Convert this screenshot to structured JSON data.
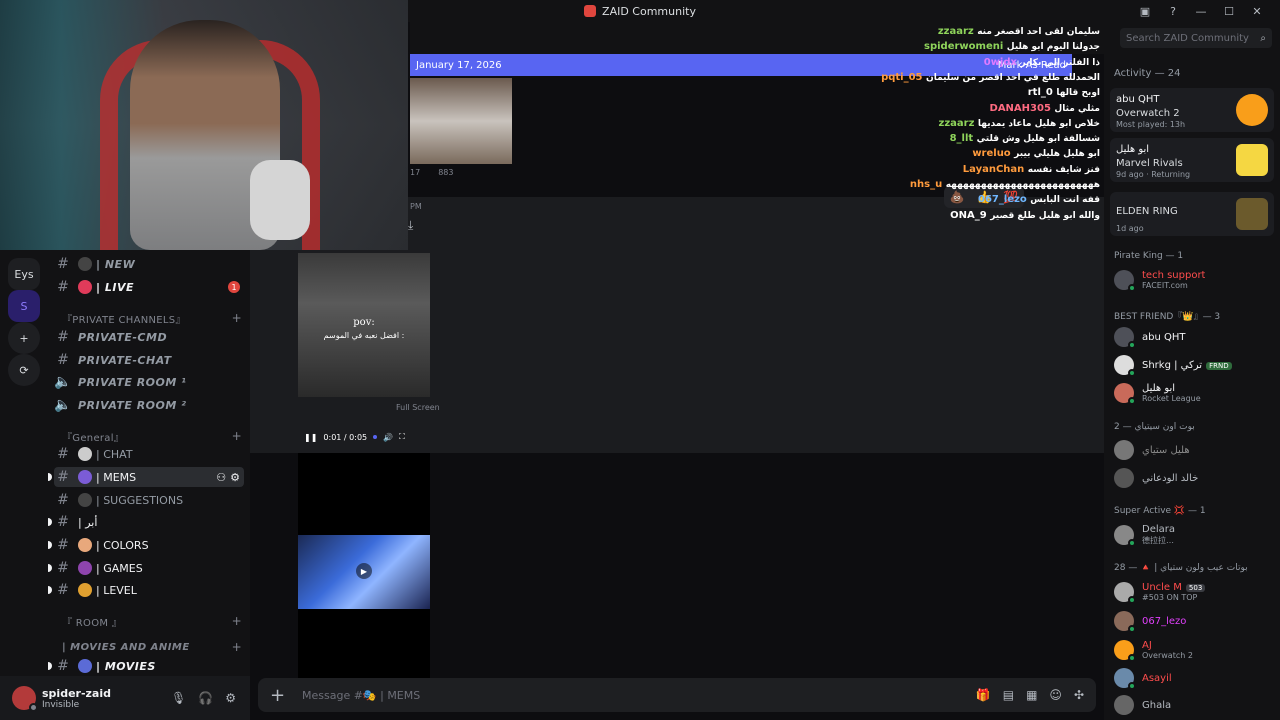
{
  "window": {
    "title": "ZAID Community",
    "controls": [
      "—",
      "☐",
      "✕"
    ]
  },
  "rail": {
    "items": [
      "Eys",
      "S",
      "+",
      "⟳"
    ]
  },
  "sidebar": {
    "channels": [
      {
        "label": "| NEW",
        "type": "text",
        "style": "italic"
      },
      {
        "label": "| LIVE",
        "type": "text",
        "style": "italic",
        "badge": "1"
      },
      {
        "label": "『PRIVATE CHANNELS』",
        "type": "category"
      },
      {
        "label": "PRIVATE-CMD",
        "type": "text",
        "style": "italic"
      },
      {
        "label": "PRIVATE-CHAT",
        "type": "text",
        "style": "italic"
      },
      {
        "label": "PRIVATE ROOM ¹",
        "type": "voice",
        "style": "italic"
      },
      {
        "label": "PRIVATE ROOM ²",
        "type": "voice",
        "style": "italic"
      },
      {
        "label": "『General』",
        "type": "category"
      },
      {
        "label": "| CHAT",
        "type": "text"
      },
      {
        "label": "| MEMS",
        "type": "text",
        "active": true
      },
      {
        "label": "| SUGGESTIONS",
        "type": "text"
      },
      {
        "label": "| أبر",
        "type": "text"
      },
      {
        "label": "| COLORS",
        "type": "text"
      },
      {
        "label": "| GAMES",
        "type": "text"
      },
      {
        "label": "| LEVEL",
        "type": "text"
      },
      {
        "label": "『 ROOM 』",
        "type": "category"
      },
      {
        "label": "| MOVIES AND ANIME",
        "type": "category"
      },
      {
        "label": "| MOVIES",
        "type": "text",
        "style": "italic"
      }
    ]
  },
  "user": {
    "name": "spider-zaid",
    "status": "Invisible"
  },
  "chat": {
    "new_bar_date": "January 17, 2026",
    "mark_as_read": "Mark As Read",
    "reaction_counts": [
      "17",
      "883"
    ],
    "time_stub": "PM",
    "video": {
      "pov": "pov:",
      "caption": "افضل نعبه في الموسم :",
      "time": "0:01 / 0:05",
      "fullscreen_tip": "Full Screen"
    },
    "composer_placeholder": "Message #🎭 | MEMS"
  },
  "stream_chat": [
    {
      "name": "zzaarz",
      "text": "سليمان لقى احد اقصغر منه",
      "color": "#8fd45b"
    },
    {
      "name": "spiderwomeni",
      "text": "جدولنا اليوم ابو هليل",
      "color": "#8fd45b"
    },
    {
      "name": "0wjdx",
      "text": "ذا الفلتر الي بكابر",
      "color": "#e07bff"
    },
    {
      "name": "pqti_05",
      "text": "الحمدلله طلع في احد اقصر من سليمان",
      "color": "#ff9b3d"
    },
    {
      "name": "rtl_0",
      "text": "اوبح قالها",
      "color": "#ffffff"
    },
    {
      "name": "DANAH305",
      "text": "مثلي مثال",
      "color": "#ff6b81"
    },
    {
      "name": "zzaarz",
      "text": "خلاص ابو هليل ماعاد يمديها",
      "color": "#8fd45b"
    },
    {
      "name": "8_llt",
      "text": "شسالفة ابو هليل وش قلتي",
      "color": "#8fd45b"
    },
    {
      "name": "wreluo",
      "text": "ابو هليل هليلي بيبر",
      "color": "#ff9b3d"
    },
    {
      "name": "LayanChan",
      "text": "فنز شايف نفسه",
      "color": "#ff9b3d"
    },
    {
      "name": "nhs_u",
      "text": "هههههههههههههههههههههههههه",
      "color": "#ff9b3d"
    },
    {
      "name": "067_lezo",
      "text": "قفه انت البابس",
      "color": "#6fb7ff"
    },
    {
      "name": "ONA_9",
      "text": "والله ابو هليل طلع قصير",
      "color": "#ffffff"
    }
  ],
  "right": {
    "search_placeholder": "Search ZAID Community",
    "activity_header": "Activity — 24",
    "activities": [
      {
        "user": "abu QHT",
        "game": "Overwatch 2",
        "meta": "Most played: 13h",
        "color": "#f99e1a"
      },
      {
        "user": "ابو هليل",
        "game": "Marvel Rivals",
        "meta": "9d ago · Returning",
        "color": "#f5d742"
      },
      {
        "user": "",
        "game": "ELDEN RING",
        "meta": "1d ago",
        "color": "#6b5a2c"
      }
    ],
    "groups": [
      {
        "title": "Pirate King — 1",
        "members": [
          {
            "name": "tech support",
            "sub": "FACEIT.com",
            "color": "#ff4d4d"
          }
        ]
      },
      {
        "title": "BEST FRIEND『👑』— 3",
        "members": [
          {
            "name": "abu QHT",
            "sub": "",
            "color": "#f2f3f5"
          },
          {
            "name": "Shrkg | تركي",
            "sub": "",
            "color": "#f2f3f5",
            "tag": "FRND"
          },
          {
            "name": "ابو هليل",
            "sub": "Rocket League",
            "color": "#f2f3f5"
          }
        ]
      },
      {
        "title": "بوت اون سيتياي — 2",
        "members": [
          {
            "name": "هليل ستياي",
            "sub": "",
            "color": "#8a8a8a"
          },
          {
            "name": "خالد الودعاني",
            "sub": "",
            "color": "#b5bac1"
          }
        ]
      },
      {
        "title": "Super Active 💢 — 1",
        "members": [
          {
            "name": "Delara",
            "sub": "德拉拉…",
            "color": "#b5bac1"
          }
        ]
      },
      {
        "title": "بوتات عيب ولون ستياي | 🔺 — 28",
        "members": [
          {
            "name": "Uncle M",
            "sub": "#503 ON TOP",
            "color": "#ff4d4d",
            "tag": "503"
          },
          {
            "name": "067_lezo",
            "sub": "",
            "color": "#e040fb"
          },
          {
            "name": "AJ",
            "sub": "Overwatch 2",
            "color": "#ff4d4d"
          },
          {
            "name": "Asayil",
            "sub": "",
            "color": "#ff4d4d"
          },
          {
            "name": "Ghala",
            "sub": "",
            "color": "#b5bac1"
          }
        ]
      }
    ]
  }
}
